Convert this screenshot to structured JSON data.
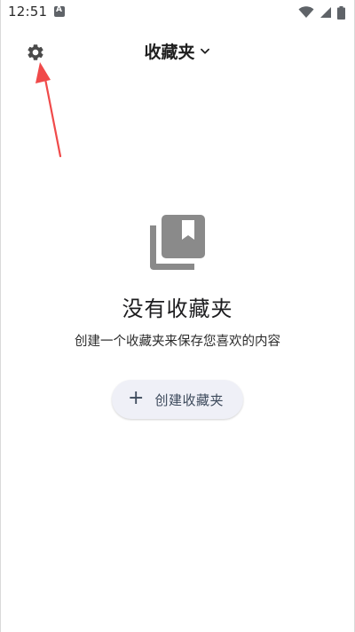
{
  "status_bar": {
    "time": "12:51",
    "notification_icon": "a-letter-icon",
    "icons": [
      "wifi-icon",
      "signal-icon",
      "battery-icon"
    ]
  },
  "app_bar": {
    "settings_icon": "gear-icon",
    "title": "收藏夹",
    "dropdown_icon": "chevron-down-icon"
  },
  "empty_state": {
    "icon": "collections-bookmark-icon",
    "title": "没有收藏夹",
    "subtitle": "创建一个收藏夹来保存您喜欢的内容",
    "create_button_icon": "plus-icon",
    "create_button_label": "创建收藏夹"
  },
  "annotation": {
    "arrow_color": "#f04a4a"
  },
  "colors": {
    "icon_gray": "#8a8a8a",
    "button_bg": "#eff0f7",
    "button_text": "#3d4a5c"
  }
}
